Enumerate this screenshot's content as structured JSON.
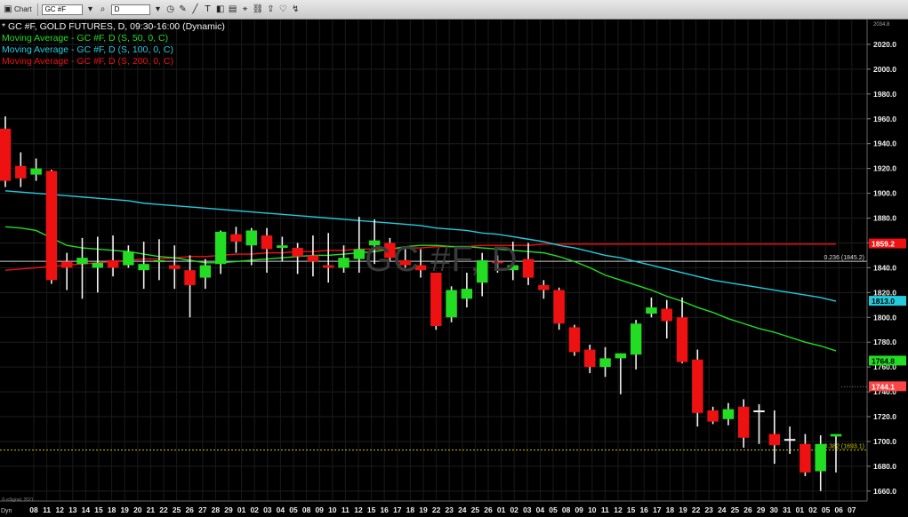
{
  "toolbar": {
    "chart_label": "Chart",
    "symbol": "GC #F",
    "interval": "D",
    "icons": [
      "search-icon",
      "clock-icon",
      "pencil-icon",
      "line-tool-icon",
      "text-tool-icon",
      "shape-tool-icon",
      "box-tool-icon",
      "cursor-icon",
      "link-icon",
      "share-icon",
      "favorite-icon",
      "pin-icon"
    ]
  },
  "legend": {
    "title": "* GC #F, GOLD FUTURES, D, 09:30-16:00 (Dynamic)",
    "ma50": "Moving Average - GC #F, D (S, 50, 0, C)",
    "ma100": "Moving Average - GC #F, D (S, 100, 0, C)",
    "ma200": "Moving Average - GC #F, D (S, 200, 0, C)"
  },
  "watermark": "GC #F, D",
  "copyright": "© eSignal, 2021",
  "time_axis_label": "Dyn",
  "colors": {
    "up": "#22dd22",
    "down": "#ee1111",
    "neutral": "#f2f2f2",
    "ma50": "#22dd22",
    "ma100": "#22ccdd",
    "ma200": "#ee1111",
    "fib": "#cccccc",
    "fib382": "#c8c800"
  },
  "chart_data": {
    "type": "candlestick",
    "ylim": [
      1652,
      2040
    ],
    "yticks": [
      "2020.0",
      "2000.0",
      "1980.0",
      "1960.0",
      "1940.0",
      "1920.0",
      "1900.0",
      "1880.0",
      "1860.0",
      "1840.0",
      "1820.0",
      "1800.0",
      "1780.0",
      "1760.0",
      "1740.0",
      "1720.0",
      "1700.0",
      "1680.0",
      "1660.0"
    ],
    "xticks": [
      "08",
      "11",
      "12",
      "13",
      "14",
      "15",
      "18",
      "19",
      "20",
      "21",
      "22",
      "25",
      "26",
      "27",
      "28",
      "29",
      "01",
      "02",
      "03",
      "04",
      "05",
      "08",
      "09",
      "10",
      "11",
      "12",
      "15",
      "16",
      "17",
      "18",
      "19",
      "22",
      "23",
      "24",
      "25",
      "26",
      "01",
      "02",
      "03",
      "04",
      "05",
      "08",
      "09",
      "10",
      "11",
      "12",
      "15",
      "16",
      "17",
      "18",
      "19",
      "22",
      "23",
      "24",
      "25",
      "26",
      "29",
      "30",
      "31",
      "01",
      "02",
      "05",
      "06",
      "07"
    ],
    "ohlc": [
      [
        1952,
        1962,
        1905,
        1910
      ],
      [
        1922,
        1933,
        1905,
        1912
      ],
      [
        1915,
        1928,
        1910,
        1920
      ],
      [
        1918,
        1919,
        1827,
        1830
      ],
      [
        1845,
        1852,
        1822,
        1840
      ],
      [
        1843,
        1864,
        1815,
        1848
      ],
      [
        1840,
        1865,
        1820,
        1844
      ],
      [
        1846,
        1866,
        1833,
        1840
      ],
      [
        1842,
        1858,
        1840,
        1853
      ],
      [
        1838,
        1861,
        1823,
        1843
      ],
      [
        1845,
        1863,
        1830,
        1846
      ],
      [
        1842,
        1858,
        1823,
        1839
      ],
      [
        1838,
        1850,
        1800,
        1826
      ],
      [
        1832,
        1847,
        1823,
        1842
      ],
      [
        1843,
        1870,
        1835,
        1869
      ],
      [
        1867,
        1873,
        1852,
        1861
      ],
      [
        1858,
        1872,
        1842,
        1870
      ],
      [
        1866,
        1872,
        1836,
        1855
      ],
      [
        1856,
        1865,
        1845,
        1858
      ],
      [
        1856,
        1860,
        1835,
        1849
      ],
      [
        1850,
        1866,
        1833,
        1845
      ],
      [
        1842,
        1868,
        1828,
        1840
      ],
      [
        1840,
        1858,
        1836,
        1848
      ],
      [
        1847,
        1881,
        1836,
        1855
      ],
      [
        1858,
        1879,
        1843,
        1862
      ],
      [
        1860,
        1864,
        1845,
        1848
      ],
      [
        1846,
        1855,
        1840,
        1842
      ],
      [
        1842,
        1855,
        1832,
        1838
      ],
      [
        1836,
        1836,
        1790,
        1793
      ],
      [
        1800,
        1825,
        1796,
        1822
      ],
      [
        1815,
        1836,
        1808,
        1823
      ],
      [
        1828,
        1852,
        1817,
        1846
      ],
      [
        1845,
        1850,
        1836,
        1844
      ],
      [
        1838,
        1861,
        1830,
        1842
      ],
      [
        1847,
        1860,
        1826,
        1832
      ],
      [
        1826,
        1830,
        1815,
        1822
      ],
      [
        1822,
        1824,
        1790,
        1795
      ],
      [
        1792,
        1794,
        1769,
        1772
      ],
      [
        1774,
        1778,
        1755,
        1760
      ],
      [
        1760,
        1776,
        1752,
        1767
      ],
      [
        1767,
        1771,
        1738,
        1771
      ],
      [
        1770,
        1798,
        1758,
        1795
      ],
      [
        1803,
        1816,
        1800,
        1808
      ],
      [
        1807,
        1814,
        1783,
        1797
      ],
      [
        1800,
        1816,
        1763,
        1764
      ],
      [
        1766,
        1774,
        1712,
        1723
      ],
      [
        1725,
        1728,
        1714,
        1716
      ],
      [
        1718,
        1731,
        1713,
        1726
      ],
      [
        1728,
        1734,
        1695,
        1703
      ],
      [
        1725,
        1730,
        1698,
        1725
      ],
      [
        1706,
        1725,
        1682,
        1697
      ],
      [
        1702,
        1712,
        1690,
        1702
      ],
      [
        1698,
        1706,
        1672,
        1675
      ],
      [
        1676,
        1705,
        1660,
        1698
      ],
      [
        1704,
        1705,
        1675,
        1706
      ]
    ],
    "ma50": [
      [
        1873
      ],
      [
        1872
      ],
      [
        1870
      ],
      [
        1864
      ],
      [
        1858
      ],
      [
        1856
      ],
      [
        1855
      ],
      [
        1854
      ],
      [
        1853
      ],
      [
        1851
      ],
      [
        1849
      ],
      [
        1848
      ],
      [
        1846
      ],
      [
        1844
      ],
      [
        1844
      ],
      [
        1845
      ],
      [
        1846
      ],
      [
        1847
      ],
      [
        1848
      ],
      [
        1849
      ],
      [
        1850
      ],
      [
        1850
      ],
      [
        1851
      ],
      [
        1852
      ],
      [
        1853
      ],
      [
        1855
      ],
      [
        1857
      ],
      [
        1858
      ],
      [
        1858
      ],
      [
        1857
      ],
      [
        1857
      ],
      [
        1856
      ],
      [
        1855
      ],
      [
        1854
      ],
      [
        1853
      ],
      [
        1852
      ],
      [
        1849
      ],
      [
        1845
      ],
      [
        1840
      ],
      [
        1834
      ],
      [
        1830
      ],
      [
        1826
      ],
      [
        1822
      ],
      [
        1817
      ],
      [
        1813
      ],
      [
        1808
      ],
      [
        1804
      ],
      [
        1799
      ],
      [
        1795
      ],
      [
        1791
      ],
      [
        1788
      ],
      [
        1784
      ],
      [
        1780
      ],
      [
        1777
      ],
      [
        1773
      ]
    ],
    "ma100": [
      [
        1902
      ],
      [
        1901
      ],
      [
        1900
      ],
      [
        1899
      ],
      [
        1898
      ],
      [
        1897
      ],
      [
        1896
      ],
      [
        1895
      ],
      [
        1894
      ],
      [
        1892
      ],
      [
        1891
      ],
      [
        1890
      ],
      [
        1889
      ],
      [
        1888
      ],
      [
        1887
      ],
      [
        1886
      ],
      [
        1885
      ],
      [
        1884
      ],
      [
        1883
      ],
      [
        1882
      ],
      [
        1881
      ],
      [
        1880
      ],
      [
        1879
      ],
      [
        1878
      ],
      [
        1877
      ],
      [
        1876
      ],
      [
        1875
      ],
      [
        1874
      ],
      [
        1872
      ],
      [
        1871
      ],
      [
        1870
      ],
      [
        1868
      ],
      [
        1867
      ],
      [
        1865
      ],
      [
        1863
      ],
      [
        1861
      ],
      [
        1858
      ],
      [
        1856
      ],
      [
        1853
      ],
      [
        1850
      ],
      [
        1848
      ],
      [
        1845
      ],
      [
        1842
      ],
      [
        1839
      ],
      [
        1836
      ],
      [
        1833
      ],
      [
        1830
      ],
      [
        1828
      ],
      [
        1826
      ],
      [
        1824
      ],
      [
        1822
      ],
      [
        1820
      ],
      [
        1818
      ],
      [
        1816
      ],
      [
        1813
      ]
    ],
    "ma200": [
      [
        1838
      ],
      [
        1839
      ],
      [
        1840
      ],
      [
        1841
      ],
      [
        1842
      ],
      [
        1843
      ],
      [
        1844
      ],
      [
        1845
      ],
      [
        1846
      ],
      [
        1847
      ],
      [
        1847
      ],
      [
        1848
      ],
      [
        1849
      ],
      [
        1849
      ],
      [
        1850
      ],
      [
        1851
      ],
      [
        1851
      ],
      [
        1852
      ],
      [
        1852
      ],
      [
        1853
      ],
      [
        1853
      ],
      [
        1854
      ],
      [
        1854
      ],
      [
        1855
      ],
      [
        1855
      ],
      [
        1855
      ],
      [
        1856
      ],
      [
        1856
      ],
      [
        1857
      ],
      [
        1857
      ],
      [
        1857
      ],
      [
        1858
      ],
      [
        1858
      ],
      [
        1858
      ],
      [
        1858
      ],
      [
        1859
      ],
      [
        1859
      ],
      [
        1859
      ],
      [
        1859
      ],
      [
        1859
      ],
      [
        1859
      ],
      [
        1859
      ],
      [
        1859
      ],
      [
        1859
      ],
      [
        1859
      ],
      [
        1859
      ],
      [
        1859
      ],
      [
        1859
      ],
      [
        1859
      ],
      [
        1859
      ],
      [
        1859
      ],
      [
        1859
      ],
      [
        1859
      ],
      [
        1859
      ],
      [
        1859
      ]
    ],
    "last_values": {
      "ma200": "1859.2",
      "ma100": "1813.0",
      "ma50": "1764.8",
      "price": "1744.1",
      "top": "2034.8"
    },
    "fib_levels": [
      {
        "label": "0.236 (1845.2)",
        "value": 1845.2
      },
      {
        "label": "0.382 (1693.1)",
        "value": 1693.1
      }
    ]
  }
}
